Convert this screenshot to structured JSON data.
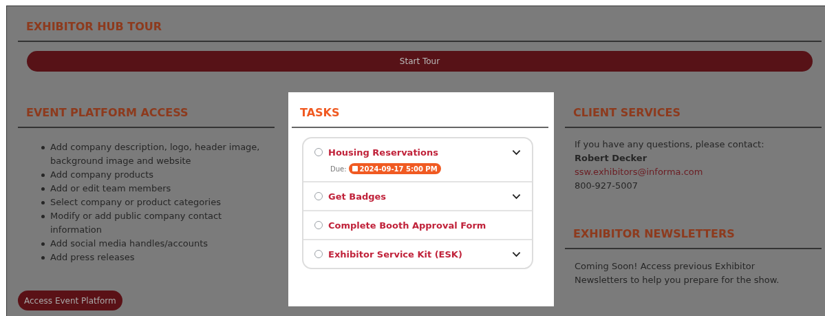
{
  "tour": {
    "title": "EXHIBITOR HUB TOUR",
    "button": "Start Tour"
  },
  "event_platform": {
    "title": "EVENT PLATFORM ACCESS",
    "items": [
      "Add company description, logo, header image, background image and website",
      "Add company products",
      "Add or edit team members",
      "Select company or product categories",
      "Modify or add public company contact information",
      "Add social media handles/accounts",
      "Add press releases"
    ],
    "button": "Access Event Platform"
  },
  "tasks": {
    "title": "TASKS",
    "items": [
      {
        "title": "Housing Reservations",
        "checked": false,
        "expandable": true,
        "due_label": "Due:",
        "due": "2024-09-17 5:00 PM"
      },
      {
        "title": "Get Badges",
        "checked": false,
        "expandable": true
      },
      {
        "title": "Complete Booth Approval Form",
        "checked": false,
        "expandable": false
      },
      {
        "title": "Exhibitor Service Kit (ESK)",
        "checked": false,
        "expandable": true
      }
    ]
  },
  "client_services": {
    "title": "CLIENT SERVICES",
    "intro": "If you have any questions, please contact:",
    "name": "Robert Decker",
    "email": "ssw.exhibitors@informa.com",
    "phone": "800-927-5007"
  },
  "newsletters": {
    "title": "EXHIBITOR NEWSLETTERS",
    "text": "Coming Soon!  Access previous Exhibitor Newsletters to help you prepare for the show."
  }
}
